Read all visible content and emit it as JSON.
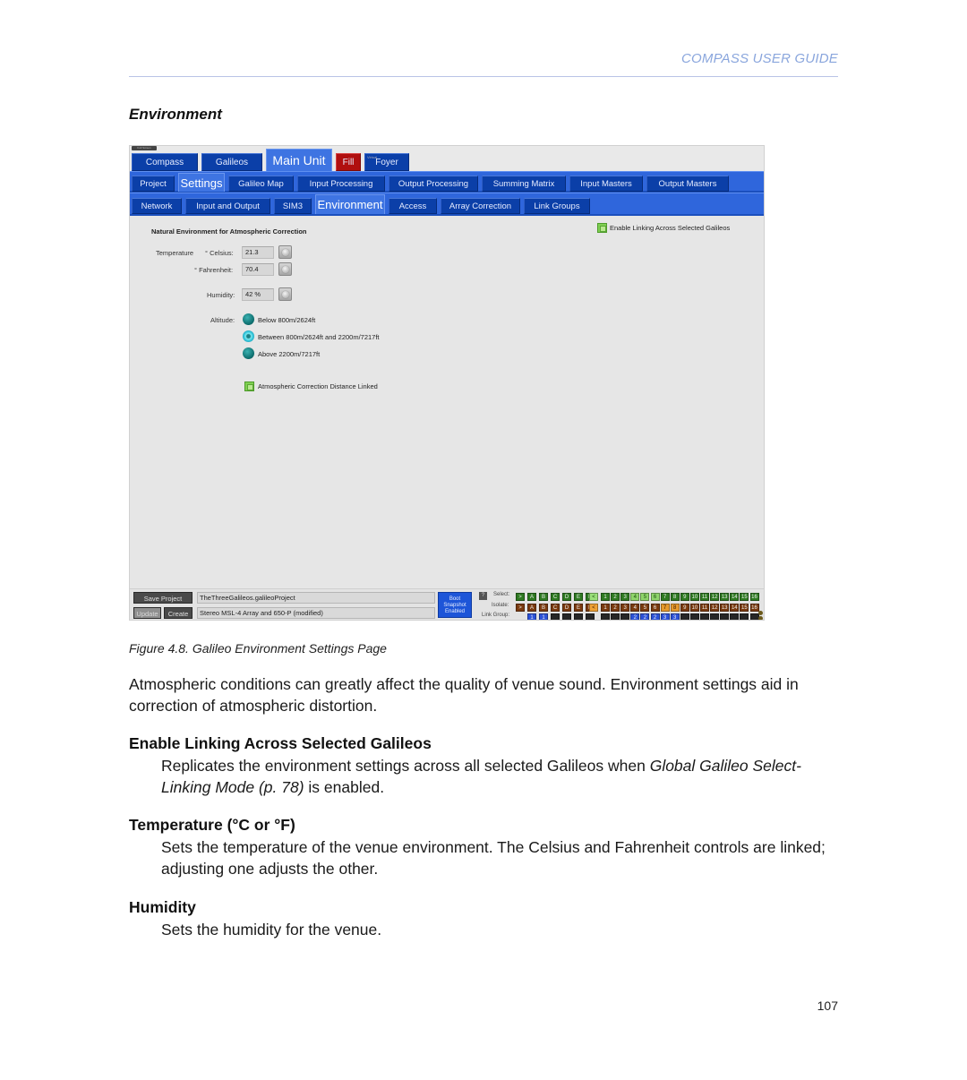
{
  "header": {
    "running_head": "COMPASS USER GUIDE",
    "section_title": "Environment"
  },
  "app": {
    "fullscreen_label": "Full Screen",
    "tabs_row1": [
      {
        "label": "Compass",
        "active": false
      },
      {
        "label": "Galileos",
        "active": false
      },
      {
        "label": "Main Unit",
        "active": true
      },
      {
        "label": "Fill",
        "active": false,
        "color": "#b00f0f"
      },
      {
        "label": "Foyer",
        "active": false,
        "superscript": "Virtual"
      }
    ],
    "tabs_row2": [
      {
        "label": "Project",
        "active": false
      },
      {
        "label": "Settings",
        "active": true
      },
      {
        "label": "Galileo Map",
        "active": false
      },
      {
        "label": "Input Processing",
        "active": false
      },
      {
        "label": "Output Processing",
        "active": false
      },
      {
        "label": "Summing Matrix",
        "active": false
      },
      {
        "label": "Input Masters",
        "active": false
      },
      {
        "label": "Output Masters",
        "active": false
      }
    ],
    "tabs_row3": [
      {
        "label": "Network",
        "active": false
      },
      {
        "label": "Input and Output",
        "active": false
      },
      {
        "label": "SIM3",
        "active": false
      },
      {
        "label": "Environment",
        "active": true
      },
      {
        "label": "Access",
        "active": false
      },
      {
        "label": "Array Correction",
        "active": false
      },
      {
        "label": "Link Groups",
        "active": false
      }
    ],
    "environment": {
      "group_title": "Natural Environment for Atmospheric Correction",
      "enable_linking_label": "Enable Linking Across Selected Galileos",
      "enable_linking_checked": true,
      "temperature_label": "Temperature",
      "celsius_label": "° Celsius:",
      "celsius_value": "21.3",
      "fahrenheit_label": "° Fahrenheit:",
      "fahrenheit_value": "70.4",
      "humidity_label": "Humidity:",
      "humidity_value": "42 %",
      "altitude_label": "Altitude:",
      "altitude_options": [
        {
          "label": "Below 800m/2624ft",
          "selected": false
        },
        {
          "label": "Between 800m/2624ft and 2200m/7217ft",
          "selected": true
        },
        {
          "label": "Above 2200m/7217ft",
          "selected": false
        }
      ],
      "distance_linked_label": "Atmospheric Correction Distance Linked",
      "distance_linked_checked": true
    },
    "bottom": {
      "save_project_label": "Save Project",
      "update_label": "Update",
      "create_label": "Create",
      "project_file": "TheThreeGalileos.galileoProject",
      "snapshot_name": "Stereo MSL-4 Array and 650-P (modified)",
      "snapshot_status_lines": [
        "Boot",
        "Snapshot",
        "Enabled"
      ],
      "help_label": "?",
      "select_label": "Select:",
      "isolate_label": "Isolate:",
      "link_group_label": "Link Group:",
      "arrow_right": ">",
      "arrow_left": "<",
      "letter_channels": [
        "A",
        "B",
        "C",
        "D",
        "E",
        "F"
      ],
      "number_channels": [
        "1",
        "2",
        "3",
        "4",
        "5",
        "6",
        "7",
        "8",
        "9",
        "10",
        "11",
        "12",
        "13",
        "14",
        "15",
        "16"
      ],
      "select_highlighted_numbers": [
        "4",
        "5",
        "6"
      ],
      "isolate_highlighted_numbers": [
        "7",
        "8"
      ],
      "link_groups_letters": [
        "1",
        "1",
        "",
        "",
        "",
        ""
      ],
      "link_groups_numbers": [
        "",
        "",
        "",
        "2",
        "2",
        "2",
        "3",
        "3",
        "",
        "",
        "",
        "",
        "",
        "",
        "",
        ""
      ]
    }
  },
  "figure_caption": "Figure 4.8. Galileo Environment Settings Page",
  "body": {
    "intro": "Atmospheric conditions can greatly affect the quality of venue sound. Environment settings aid in correction of atmospheric distortion.",
    "items": [
      {
        "term": "Enable Linking Across Selected Galileos",
        "desc_before": "Replicates the environment settings across all selected Galileos when ",
        "desc_link": "Global Galileo Select-Linking Mode (p. 78)",
        "desc_after": " is enabled."
      },
      {
        "term": "Temperature (°C or °F)",
        "desc": "Sets the temperature of the venue environment. The Celsius and Fahrenheit controls are linked; adjusting one adjusts the other."
      },
      {
        "term": "Humidity",
        "desc": "Sets the humidity for the venue."
      }
    ]
  },
  "page_number": "107"
}
